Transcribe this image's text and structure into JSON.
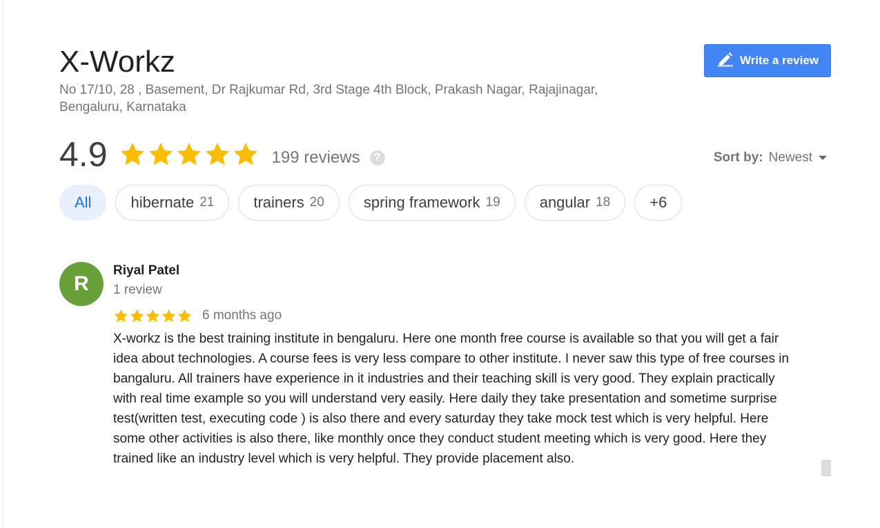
{
  "business": {
    "name": "X-Workz",
    "address": "No 17/10, 28 , Basement, Dr Rajkumar Rd, 3rd Stage 4th Block, Prakash Nagar, Rajajinagar, Bengaluru, Karnataka"
  },
  "write_review": {
    "label": "Write a review",
    "icon": "pencil-icon"
  },
  "summary": {
    "rating": "4.9",
    "stars": 4.9,
    "reviews_label": "199 reviews",
    "help_icon": "?"
  },
  "sort": {
    "label": "Sort by:",
    "value": "Newest",
    "icon": "dropdown-arrow-icon"
  },
  "chips": [
    {
      "label": "All",
      "count": "",
      "active": true
    },
    {
      "label": "hibernate",
      "count": "21"
    },
    {
      "label": "trainers",
      "count": "20"
    },
    {
      "label": "spring framework",
      "count": "19"
    },
    {
      "label": "angular",
      "count": "18"
    },
    {
      "label": "+6",
      "count": ""
    }
  ],
  "review": {
    "avatar_letter": "R",
    "author": "Riyal Patel",
    "author_sub": "1 review",
    "stars": 5,
    "time": "6 months ago",
    "text": "X-workz is the best training institute in bengaluru. Here one month free course is available so that you will get a fair idea about technologies. A course fees is very less compare to other institute. I never saw this type of free courses in bangaluru. All trainers have experience in it industries and their teaching skill is very good. They explain practically with real time example so you will understand very easily. Here daily they take presentation and sometime surprise test(written test, executing code ) is also there and every saturday they take mock test which is very helpful. Here some other activities is also there, like monthly once they conduct student meeting which is very good. Here they trained like an industry level which is very helpful. They provide placement also."
  },
  "colors": {
    "star": "#fbbc04",
    "button": "#4285f4",
    "chip_active_bg": "#e8f0fe",
    "chip_active_text": "#1a73e8",
    "avatar": "#689f38"
  }
}
